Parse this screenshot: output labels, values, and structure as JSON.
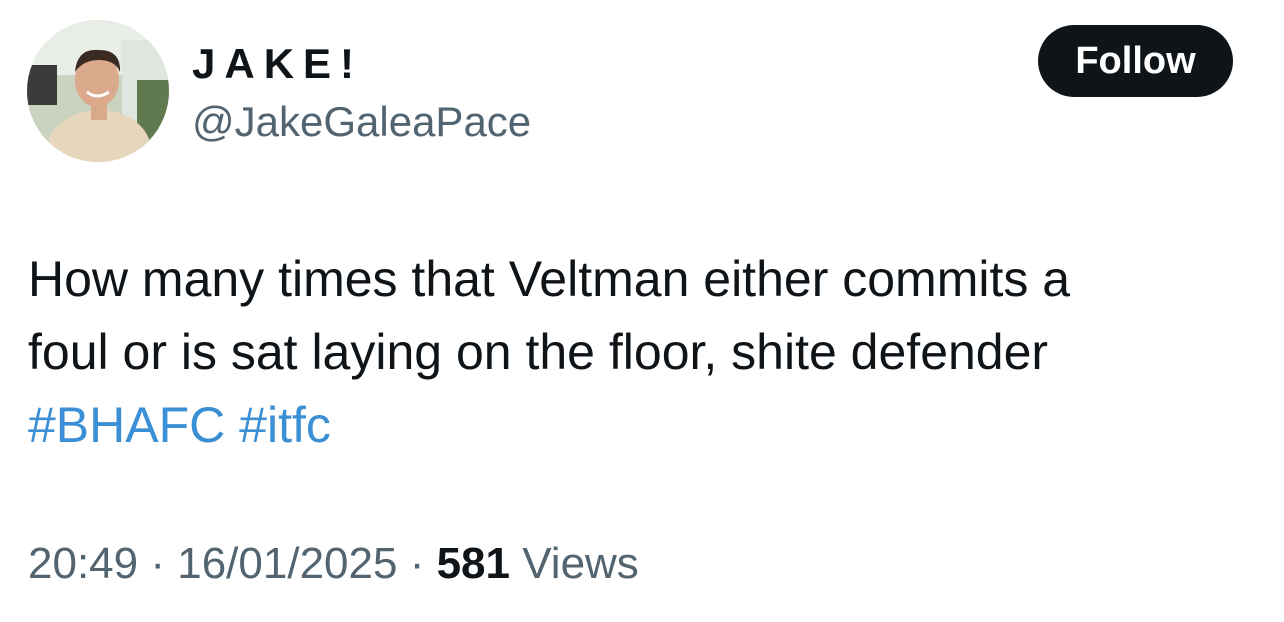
{
  "author": {
    "display_name": "JAKE!",
    "handle": "@JakeGaleaPace"
  },
  "follow_button": {
    "label": "Follow"
  },
  "tweet": {
    "line1": "How many times that Veltman either commits a",
    "line2": "foul or is sat laying on the floor, shite defender",
    "hashtags": [
      "#BHAFC",
      "#itfc"
    ]
  },
  "meta": {
    "time": "20:49",
    "separator": "·",
    "date": "16/01/2025",
    "views_count": "581",
    "views_label": "Views"
  },
  "colors": {
    "text": "#0f1419",
    "secondary": "#536471",
    "link": "#3b8fd4",
    "button_bg": "#0f1419"
  }
}
